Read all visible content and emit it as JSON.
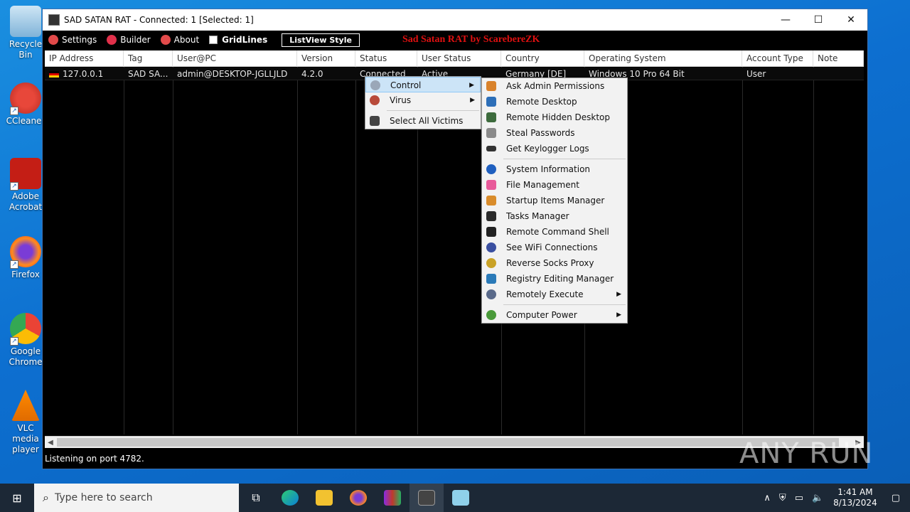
{
  "desktop": {
    "icons": [
      {
        "label": "Recycle Bin"
      },
      {
        "label": "CCleaner"
      },
      {
        "label": "Adobe Acrobat"
      },
      {
        "label": "Firefox"
      },
      {
        "label": "Google Chrome"
      },
      {
        "label": "VLC media player"
      }
    ]
  },
  "window": {
    "title": "SAD SATAN RAT - Connected: 1 [Selected: 1]",
    "minimize": "—",
    "maximize": "☐",
    "close": "✕"
  },
  "menu": {
    "settings": "Settings",
    "builder": "Builder",
    "about": "About",
    "gridlines": "GridLines",
    "listview_style": "ListView Style",
    "banner": "Sad Satan RAT by ScarebereZK"
  },
  "table": {
    "columns": [
      "IP Address",
      "Tag",
      "User@PC",
      "Version",
      "Status",
      "User Status",
      "Country",
      "Operating System",
      "Account Type",
      "Note"
    ],
    "rows": [
      [
        "127.0.0.1",
        "SAD SA...",
        "admin@DESKTOP-JGLLJLD",
        "4.2.0",
        "Connected",
        "Active",
        "Germany [DE]",
        "Windows 10 Pro 64 Bit",
        "User",
        ""
      ]
    ]
  },
  "context_menu": {
    "items": [
      {
        "label": "Control",
        "icon": "gear-icon",
        "submenu": true,
        "highlighted": true
      },
      {
        "label": "Virus",
        "icon": "virus-icon",
        "submenu": true
      },
      {
        "label": "Select All Victims",
        "icon": "hat-icon",
        "submenu": false
      }
    ]
  },
  "control_submenu": {
    "group1": [
      {
        "label": "Ask Admin Permissions",
        "icon": "shield-icon",
        "color": "#d9822b"
      },
      {
        "label": "Remote Desktop",
        "icon": "monitor-icon",
        "color": "#2d6fb8"
      },
      {
        "label": "Remote Hidden Desktop",
        "icon": "hidden-desktop-icon",
        "color": "#3d6b3d"
      },
      {
        "label": "Steal Passwords",
        "icon": "key-icon",
        "color": "#8a8a8a"
      },
      {
        "label": "Get Keylogger Logs",
        "icon": "keyboard-icon",
        "color": "#333333"
      }
    ],
    "group2": [
      {
        "label": "System Information",
        "icon": "info-icon",
        "color": "#1f5fbf"
      },
      {
        "label": "File Management",
        "icon": "folder-icon",
        "color": "#e85a9a"
      },
      {
        "label": "Startup Items Manager",
        "icon": "rocket-icon",
        "color": "#d98c2b"
      },
      {
        "label": "Tasks Manager",
        "icon": "tasks-icon",
        "color": "#2b2b2b"
      },
      {
        "label": "Remote Command Shell",
        "icon": "terminal-icon",
        "color": "#222222"
      },
      {
        "label": "See WiFi Connections",
        "icon": "wifi-icon",
        "color": "#3a4fa0"
      },
      {
        "label": "Reverse Socks Proxy",
        "icon": "proxy-icon",
        "color": "#c9a227"
      },
      {
        "label": "Registry Editing Manager",
        "icon": "registry-icon",
        "color": "#2a7ab8"
      },
      {
        "label": "Remotely Execute",
        "icon": "execute-icon",
        "color": "#5a6a8a",
        "submenu": true
      }
    ],
    "group3": [
      {
        "label": "Computer Power",
        "icon": "power-icon",
        "color": "#4a9a3a",
        "submenu": true
      }
    ]
  },
  "status_bar": {
    "text": "Listening on port 4782."
  },
  "taskbar": {
    "search_placeholder": "Type here to search",
    "time": "1:41 AM",
    "date": "8/13/2024"
  },
  "watermark": "ANY RUN"
}
